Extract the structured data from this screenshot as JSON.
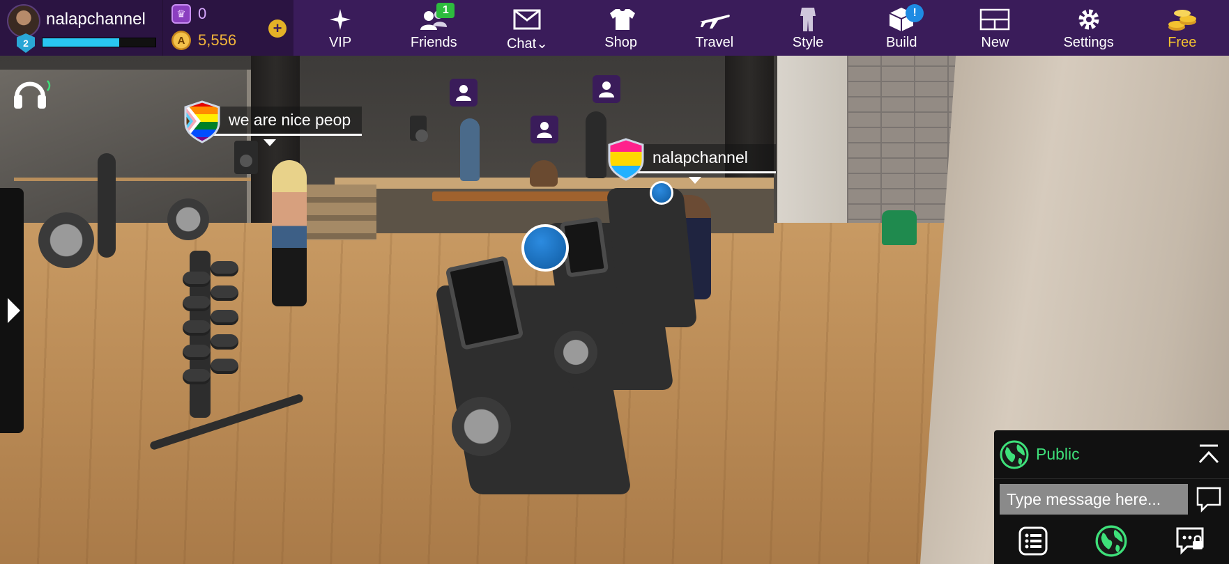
{
  "profile": {
    "username": "nalapchannel",
    "level": "2",
    "xp_progress": 0.68
  },
  "currency": {
    "credits": "0",
    "coins": "5,556"
  },
  "nav": {
    "items": [
      {
        "label": "VIP",
        "icon": "vip-star-icon"
      },
      {
        "label": "Friends",
        "icon": "friends-icon",
        "badge": "1"
      },
      {
        "label": "Chat⌄",
        "icon": "chat-envelope-icon"
      },
      {
        "label": "Shop",
        "icon": "shop-shirt-icon"
      },
      {
        "label": "Travel",
        "icon": "travel-plane-icon"
      },
      {
        "label": "Style",
        "icon": "style-outfit-icon"
      },
      {
        "label": "Build",
        "icon": "build-box-icon",
        "badge": "!"
      },
      {
        "label": "New",
        "icon": "new-layout-icon"
      },
      {
        "label": "Settings",
        "icon": "settings-gear-icon"
      },
      {
        "label": "Free",
        "icon": "free-coins-icon"
      }
    ]
  },
  "scene": {
    "nametags": [
      {
        "text": "we are nice peop",
        "flag": "progress-pride-flag"
      },
      {
        "text": "nalapchannel",
        "flag": "pansexual-flag"
      }
    ]
  },
  "chat": {
    "channel": "Public",
    "placeholder": "Type message here..."
  },
  "colors": {
    "topbar": "#3a1c5a",
    "accent_green": "#3ee07a",
    "free_gold": "#f2c230",
    "xp_cyan": "#29c6f2"
  }
}
